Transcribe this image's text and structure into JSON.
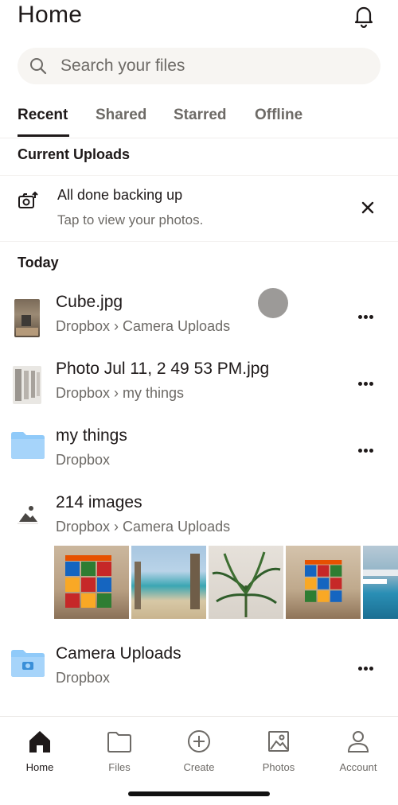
{
  "header": {
    "title": "Home",
    "bell_icon": "bell-icon"
  },
  "search": {
    "placeholder": "Search your files",
    "icon": "search-icon"
  },
  "tabs": [
    {
      "label": "Recent",
      "active": true
    },
    {
      "label": "Shared",
      "active": false
    },
    {
      "label": "Starred",
      "active": false
    },
    {
      "label": "Offline",
      "active": false
    }
  ],
  "current_uploads": {
    "title": "Current Uploads",
    "status": "All done backing up",
    "subtitle": "Tap to view your photos.",
    "icon": "camera-upload-icon",
    "close_icon": "close-icon"
  },
  "today": {
    "title": "Today",
    "items": [
      {
        "name": "Cube.jpg",
        "path": "Dropbox › Camera Uploads",
        "icon": "image-thumbnail"
      },
      {
        "name": "Photo Jul 11, 2 49 53 PM.jpg",
        "path": "Dropbox › my things",
        "icon": "document-thumbnail"
      },
      {
        "name": "my things",
        "path": "Dropbox",
        "icon": "folder-icon"
      },
      {
        "name": "214 images",
        "path": "Dropbox › Camera Uploads",
        "icon": "image-icon"
      },
      {
        "name": "Camera Uploads",
        "path": "Dropbox",
        "icon": "camera-folder-icon"
      }
    ],
    "image_strip": [
      "rubiks-cube",
      "beach-boardwalk",
      "palm-plant",
      "rubiks-cube-2",
      "pool"
    ]
  },
  "bottom_nav": [
    {
      "label": "Home",
      "icon": "home-icon",
      "active": true
    },
    {
      "label": "Files",
      "icon": "folder-icon",
      "active": false
    },
    {
      "label": "Create",
      "icon": "plus-circle-icon",
      "active": false
    },
    {
      "label": "Photos",
      "icon": "photos-icon",
      "active": false
    },
    {
      "label": "Account",
      "icon": "person-icon",
      "active": false
    }
  ],
  "colors": {
    "text": "#1e1919",
    "muted": "#6d6a66",
    "folder": "#90caf9",
    "search_bg": "#f7f5f2"
  }
}
